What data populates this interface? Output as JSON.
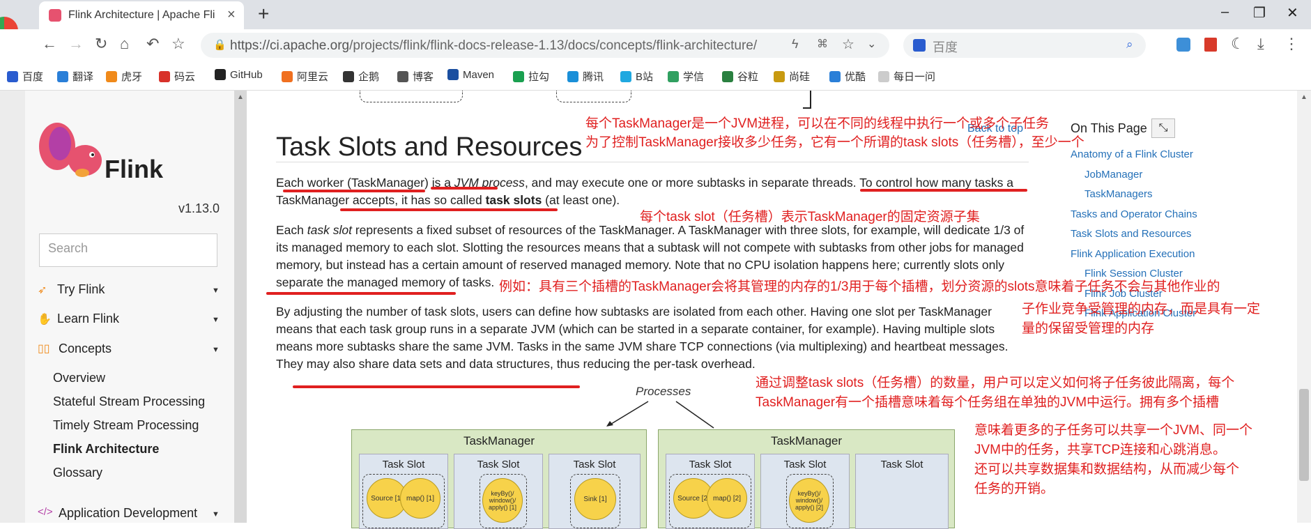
{
  "browser": {
    "tab_title": "Flink Architecture | Apache Flink",
    "new_tab": "+",
    "url_domain": "https://ci.apache.org",
    "url_path": "/projects/flink/flink-docs-release-1.13/docs/concepts/flink-architecture/",
    "search_placeholder": "百度",
    "window_controls": [
      "–",
      "❐",
      "✕"
    ]
  },
  "bookmarks": [
    "百度",
    "翻译",
    "虎牙",
    "码云",
    "GitHub",
    "阿里云",
    "企鹅",
    "博客",
    "Maven",
    "拉勾",
    "腾讯",
    "B站",
    "学信",
    "谷粒",
    "尚硅",
    "优酷",
    "每日一问"
  ],
  "bookmark_colors": [
    "#2a5ccf",
    "#2a7fd8",
    "#f08a1a",
    "#d8322a",
    "#222222",
    "#f07020",
    "#333333",
    "#555555",
    "#1a4fa0",
    "#1aa050",
    "#1a8fd8",
    "#20a8e0",
    "#30a060",
    "#2a8040",
    "#c89a10",
    "#2a7fd8",
    "#cccccc"
  ],
  "sidebar": {
    "brand": "Flink",
    "version": "v1.13.0",
    "search_placeholder": "Search",
    "sections": [
      {
        "label": "Try Flink",
        "arrow": "▼",
        "icon": "rocket-icon"
      },
      {
        "label": "Learn Flink",
        "arrow": "▼",
        "icon": "hand-icon"
      },
      {
        "label": "Concepts",
        "arrow": "▼",
        "icon": "book-icon"
      }
    ],
    "concepts_items": [
      "Overview",
      "Stateful Stream Processing",
      "Timely Stream Processing",
      "Flink Architecture",
      "Glossary"
    ],
    "active_item": "Flink Architecture",
    "app_dev": {
      "label": "Application Development",
      "arrow": "▼",
      "icon": "code-icon"
    }
  },
  "content": {
    "heading": "Task Slots and Resources",
    "p1_a": "Each worker (TaskManager) is a ",
    "p1_b": "JVM process",
    "p1_c": ", and may execute one or more subtasks in separate threads. To control how many tasks a TaskManager accepts, it has so called ",
    "p1_d": "task slots",
    "p1_e": " (at least one).",
    "p2_a": "Each ",
    "p2_b": "task slot",
    "p2_c": " represents a fixed subset of resources of the TaskManager. A TaskManager with three slots, for example, will dedicate 1/3 of its managed memory to each slot. Slotting the resources means that a subtask will not compete with subtasks from other jobs for managed memory, but instead has a certain amount of reserved managed memory. Note that no CPU isolation happens here; currently slots only separate the managed memory of tasks.",
    "p3": "By adjusting the number of task slots, users can define how subtasks are isolated from each other. Having one slot per TaskManager means that each task group runs in a separate JVM (which can be started in a separate container, for example). Having multiple slots means more subtasks share the same JVM. Tasks in the same JVM share TCP connections (via multiplexing) and heartbeat messages. They may also share data sets and data structures, thus reducing the per-task overhead."
  },
  "toc": {
    "title": "On This Page",
    "back_to_top": "Back to top",
    "items": [
      "Anatomy of a Flink Cluster",
      "JobManager",
      "TaskManagers",
      "Tasks and Operator Chains",
      "Task Slots and Resources",
      "Flink Application Execution",
      "Flink Session Cluster",
      "Flink Job Cluster",
      "Flink Application Cluster"
    ]
  },
  "annotations": {
    "a1": "每个TaskManager是一个JVM进程，可以在不同的线程中执行一个或多个子任务",
    "a2": "为了控制TaskManager接收多少任务，它有一个所谓的task slots（任务槽），至少一个",
    "a3": "每个task slot（任务槽）表示TaskManager的固定资源子集",
    "a4": "例如：具有三个插槽的TaskManager会将其管理的内存的1/3用于每个插槽，划分资源的slots意味着子任务不会与其他作业的",
    "a5": "子作业竞争受管理的内存，而是具有一定",
    "a6": "量的保留受管理的内存",
    "a7": "通过调整task slots（任务槽）的数量，用户可以定义如何将子任务彼此隔离，每个",
    "a8": "TaskManager有一个插槽意味着每个任务组在单独的JVM中运行。拥有多个插槽",
    "a9": "意味着更多的子任务可以共享一个JVM、同一个",
    "a10": "JVM中的任务，共享TCP连接和心跳消息。",
    "a11": "还可以共享数据集和数据结构，从而减少每个",
    "a12": "任务的开销。"
  },
  "diagram": {
    "processes_label": "Processes",
    "tm_label": "TaskManager",
    "slot_label": "Task Slot",
    "tm1_ops": [
      "Source [1]",
      "map() [1]",
      "keyBy()/ window()/ apply() [1]",
      "Sink [1]"
    ],
    "tm2_ops": [
      "Source [2]",
      "map() [2]",
      "keyBy()/ window()/ apply() [2]"
    ]
  },
  "colors": {
    "annotation": "#e02020",
    "link": "#2470b8",
    "tm_bg": "#d9e8c4",
    "slot_bg": "#dde5ef",
    "op": "#f7d24a"
  }
}
